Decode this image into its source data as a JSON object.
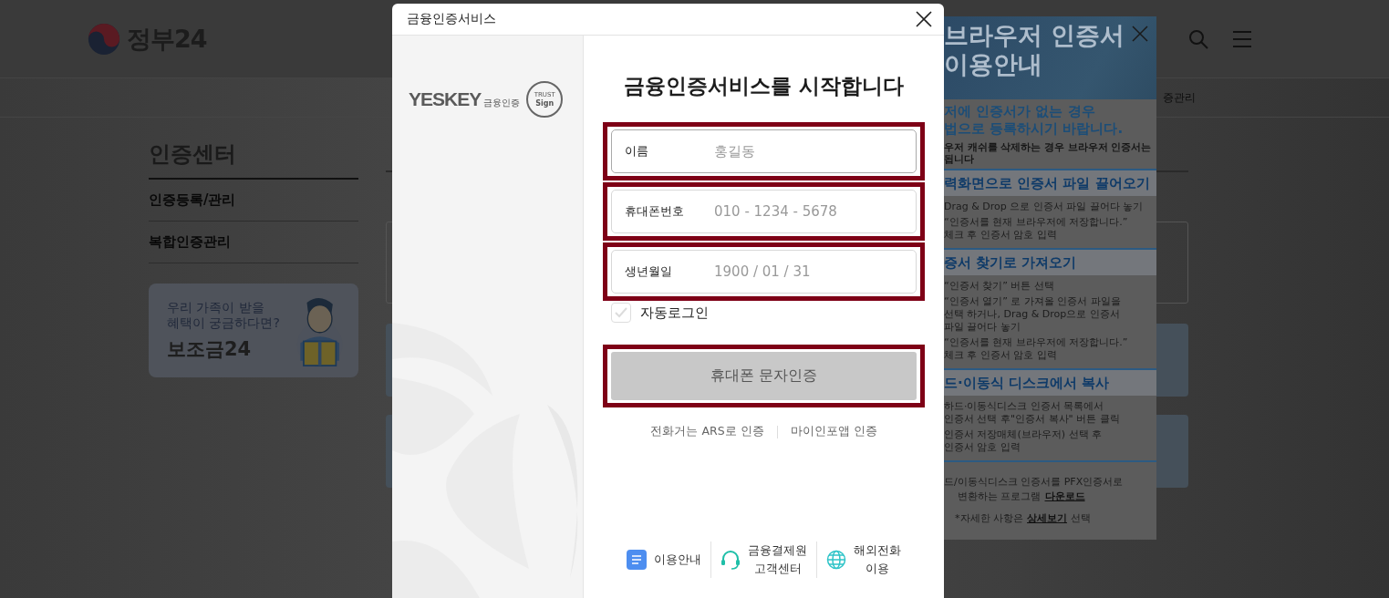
{
  "page": {
    "logo_text": "정부24",
    "breadcrumb": "증관리",
    "sidebar": {
      "title": "인증센터",
      "items": [
        {
          "label": "인증등록/관리"
        },
        {
          "label": "복합인증관리"
        }
      ]
    },
    "promo": {
      "lines": [
        "우리 가족이 받을",
        "혜택이 궁금하다면?"
      ],
      "brand": "보조금24"
    }
  },
  "cert_guide": {
    "title_lines": [
      "브라우저 인증서",
      "이용안내"
    ],
    "intro": [
      "저에 인증서가 없는 경우",
      "법으로 등록하시기 바랍니다."
    ],
    "note": [
      "우저 캐쉬를 삭제하는 경우 브라우저 인증서는",
      "됩니다"
    ],
    "sections": [
      {
        "heading": "력화면으로 인증서 파일 끌어오기",
        "steps": [
          [
            "Drag & Drop 으로 인증서 파일 끌어다 놓기"
          ],
          [
            "“인증서를 현재 브라우저에 저장합니다.”",
            "체크 후 인증서 암호 입력"
          ]
        ]
      },
      {
        "heading": "증서 찾기로 가져오기",
        "steps": [
          [
            "“인증서 찾기” 버튼 선택"
          ],
          [
            "“인증서 열기” 로 가져올 인증서 파일을",
            "선택 하거나, Drag & Drop으로 인증서",
            "파일 끌어다 놓기"
          ],
          [
            "“인증서를 현재 브라우저에 저장합니다.”",
            "체크 후 인증서 암호 입력"
          ]
        ]
      },
      {
        "heading": "드·이동식 디스크에서 복사",
        "steps": [
          [
            "하드·이동식디스크 인증서 목록에서",
            "인증서 선택 후\"인증서 복사\" 버튼 클릭"
          ],
          [
            "인증서 저장매체(브라우저) 선택 후",
            "인증서 암호 입력"
          ]
        ]
      }
    ],
    "download": {
      "line1": "드/이동식디스크 인증서를 PFX인증서로",
      "before": "변환하는 프로그램",
      "link": "다운로드"
    },
    "detail": {
      "before": "*자세한 사항은",
      "link": "상세보기",
      "after": "선택"
    }
  },
  "dialog": {
    "title": "금융인증서비스",
    "logo": {
      "brand": "YESKEY",
      "sub": "금융인증",
      "seal_top": "TRUST",
      "seal_bottom": "Sign"
    },
    "heading": "금융인증서비스를 시작합니다",
    "fields": [
      {
        "label": "이름",
        "placeholder": "홍길동",
        "highlighted": true
      },
      {
        "label": "휴대폰번호",
        "placeholder": "010 - 1234 - 5678",
        "highlighted": true
      },
      {
        "label": "생년월일",
        "placeholder": "1900 / 01 / 31",
        "highlighted": true
      }
    ],
    "auto_login": {
      "label": "자동로그인",
      "checked": false
    },
    "submit": {
      "label": "휴대폰 문자인증",
      "disabled": true,
      "highlighted": true
    },
    "alt_links": [
      "전화거는 ARS로 인증",
      "마이인포앱 인증"
    ],
    "footer": [
      {
        "kind": "document",
        "lines": [
          "이용안내"
        ]
      },
      {
        "kind": "headset",
        "lines": [
          "금융결제원",
          "고객센터"
        ]
      },
      {
        "kind": "globe",
        "lines": [
          "해외전화",
          "이용"
        ]
      }
    ]
  }
}
